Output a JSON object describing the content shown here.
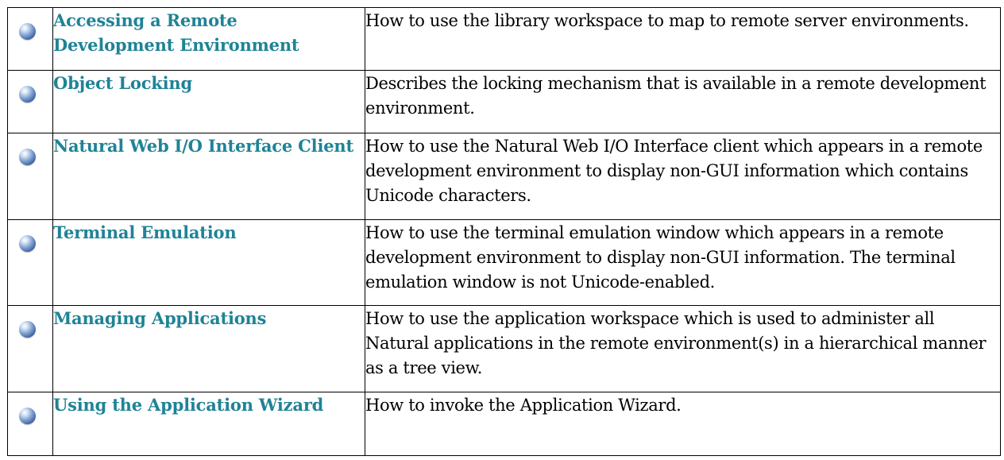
{
  "topics": [
    {
      "title": "Accessing a Remote Development Environment",
      "description": "How to use the library workspace to map to remote server environments."
    },
    {
      "title": "Object Locking",
      "description": "Describes the locking mechanism that is available in a remote development environment."
    },
    {
      "title": "Natural Web I/O Interface Client",
      "description": "How to use the Natural Web I/O Interface client which appears in a remote development environment to display non-GUI information which contains Unicode characters."
    },
    {
      "title": "Terminal Emulation",
      "description": "How to use the terminal emulation window which appears in a remote development environment to display non-GUI information. The terminal emulation window is not Unicode-enabled."
    },
    {
      "title": "Managing Applications",
      "description": "How to use the application workspace which is used to administer all Natural applications in the remote environment(s) in a hierarchical manner as a tree view."
    },
    {
      "title": "Using the Application Wizard",
      "description": "How to invoke the Application Wizard."
    }
  ],
  "icon": "blue-sphere-bullet-icon",
  "link_color": "#1f8396"
}
